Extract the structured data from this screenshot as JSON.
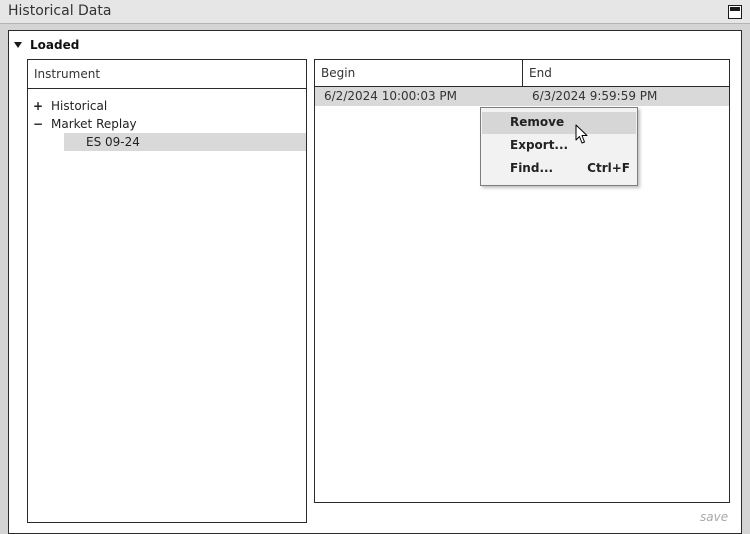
{
  "window": {
    "title": "Historical Data",
    "icons": {
      "maximize": "maximize-icon"
    }
  },
  "section": {
    "label": "Loaded",
    "icon": "expanded-triangle-icon"
  },
  "instrument_panel": {
    "header": "Instrument",
    "tree": [
      {
        "toggle": "+",
        "label": "Historical",
        "expanded": false
      },
      {
        "toggle": "−",
        "label": "Market Replay",
        "expanded": true,
        "children": [
          {
            "label": "ES 09-24",
            "selected": true
          }
        ]
      }
    ]
  },
  "dates_panel": {
    "columns": [
      "Begin",
      "End"
    ],
    "rows": [
      {
        "begin": "6/2/2024 10:00:03 PM",
        "end": "6/3/2024 9:59:59 PM",
        "selected": true
      }
    ]
  },
  "context_menu": {
    "items": [
      {
        "label": "Remove",
        "shortcut": "",
        "hovered": true
      },
      {
        "label": "Export...",
        "shortcut": ""
      },
      {
        "label": "Find...",
        "shortcut": "Ctrl+F"
      }
    ]
  },
  "footer": {
    "save_label": "save"
  },
  "colors": {
    "window_bg": "#d4d4d4",
    "titlebar_bg": "#e6e6e6",
    "selection_bg": "#d9d9d9",
    "menu_bg": "#f2f2f2",
    "menu_hover_bg": "#d6d6d6"
  }
}
